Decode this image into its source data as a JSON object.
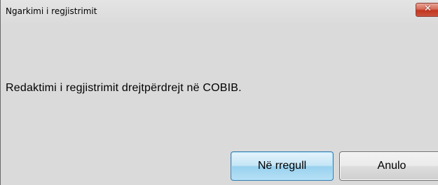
{
  "dialog": {
    "title": "Ngarkimi i regjistrimit",
    "close_label": "✕",
    "message": "Redaktimi i regjistrimit drejtpërdrejt në COBIB.",
    "buttons": {
      "ok_label": "Në rregull",
      "cancel_label": "Anulo"
    },
    "colors": {
      "background": "#dadada",
      "close_button": "#c9523c",
      "ok_button_border": "#3c7fb1"
    }
  }
}
